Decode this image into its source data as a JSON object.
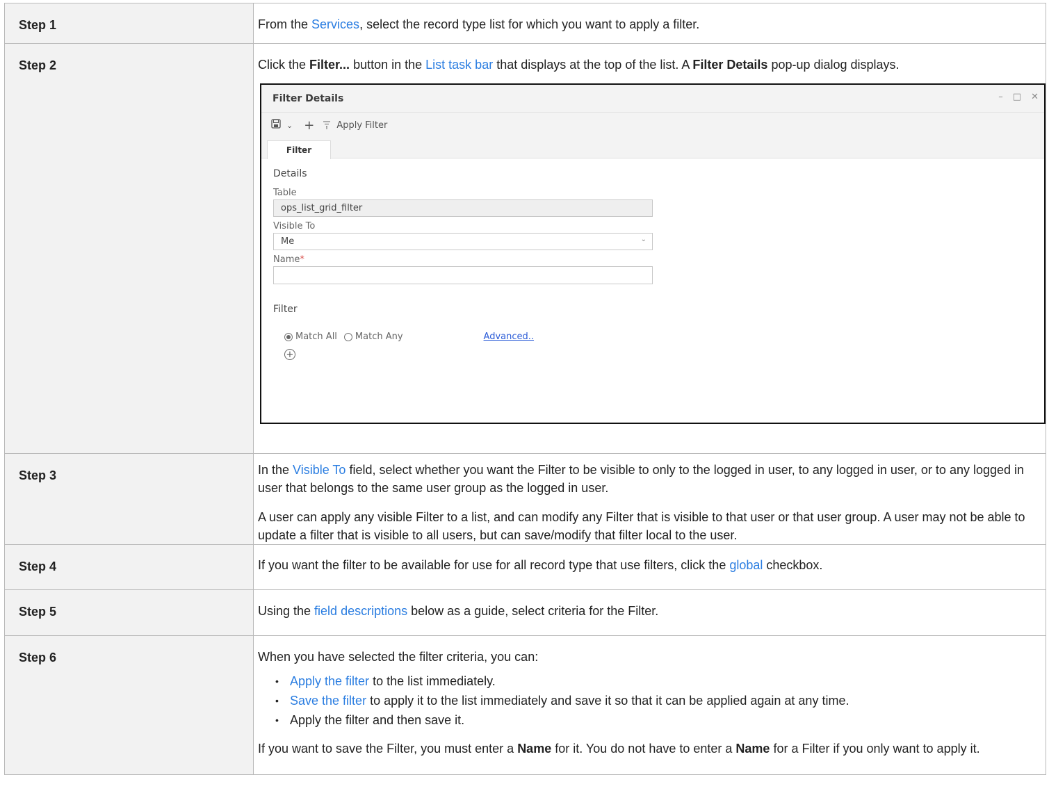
{
  "steps": [
    {
      "label": "Step 1",
      "pre": "From the ",
      "link": "Services",
      "post": ", select the record type list for which you want to apply a filter."
    },
    {
      "label": "Step 2",
      "t1": "Click the ",
      "b1": "Filter...",
      "t2": " button in the ",
      "link": "List task bar",
      "t3": " that displays at the top of the list. A ",
      "b2": "Filter Details",
      "t4": " pop-up dialog displays."
    },
    {
      "label": "Step 3",
      "t1": "In the ",
      "link": "Visible To",
      "t2": " field, select whether you want the Filter to be visible to only to the logged in user, to any logged in user, or to any logged in user that belongs to the same user group as the logged in user.",
      "p2": "A user can apply any visible Filter to a list, and can modify any Filter that is visible to that user or that user group. A user may not be able to update a filter that is visible to all users, but can save/modify that filter local to the user."
    },
    {
      "label": "Step 4",
      "t1": "If you want the filter to be available for use for all record type that use filters, click the ",
      "link": "global",
      "t2": " checkbox."
    },
    {
      "label": "Step 5",
      "t1": "Using the ",
      "link": "field descriptions",
      "t2": " below as a guide, select criteria for the Filter."
    },
    {
      "label": "Step 6",
      "intro": "When you have selected the filter criteria, you can:",
      "b1_link": "Apply the filter",
      "b1_text": " to the list immediately.",
      "b2_link": "Save the filter",
      "b2_text": " to apply it to the list immediately and save it so that it can be applied again at any time.",
      "b3_text": "Apply the filter and then save it.",
      "n1": "If you want to save the Filter, you must enter a ",
      "nb1": "Name",
      "n2": " for it. You do not have to enter a ",
      "nb2": "Name",
      "n3": " for a Filter if you only want to apply it."
    }
  ],
  "dialog": {
    "title": "Filter Details",
    "window_controls": {
      "minimize": "–",
      "maximize": "□",
      "close": "✕"
    },
    "toolbar": {
      "save_icon": "floppy-disk-icon",
      "dropdown_caret": "⌄",
      "add": "+",
      "apply_icon": "filter-icon",
      "apply_label": "Apply Filter"
    },
    "tab": "Filter",
    "details_heading": "Details",
    "table_label": "Table",
    "table_value": "ops_list_grid_filter",
    "visible_to_label": "Visible To",
    "visible_to_value": "Me",
    "name_label": "Name",
    "name_required": "*",
    "name_value": "",
    "filter_heading": "Filter",
    "match_all": "Match All",
    "match_any": "Match Any",
    "match_selected": "Match All",
    "advanced": "Advanced..",
    "add_condition": "+"
  },
  "colors": {
    "link": "#2a7de1",
    "label_bg": "#f2f2f2",
    "border": "#b9b9b9"
  }
}
